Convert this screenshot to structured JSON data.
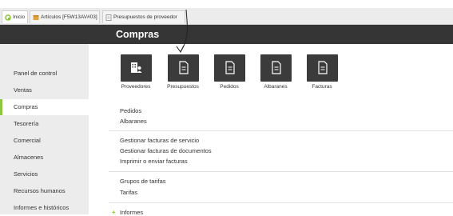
{
  "tabs": [
    {
      "label": "Inicio",
      "icon": "home-icon"
    },
    {
      "label": "Artículos [F5W13AV#03]",
      "icon": "box-icon"
    },
    {
      "label": "Presupuestos de proveedor",
      "icon": "document-icon"
    }
  ],
  "header": {
    "title": "Compras"
  },
  "sidebar": {
    "items": [
      {
        "label": "Panel de control"
      },
      {
        "label": "Ventas"
      },
      {
        "label": "Compras"
      },
      {
        "label": "Tesorería"
      },
      {
        "label": "Comercial"
      },
      {
        "label": "Almacenes"
      },
      {
        "label": "Servicios"
      },
      {
        "label": "Recursos humanos"
      },
      {
        "label": "Informes e históricos"
      }
    ],
    "active_index": 2
  },
  "tiles": [
    {
      "label": "Proveedores",
      "icon": "suppliers-icon"
    },
    {
      "label": "Presupuestos",
      "icon": "document-icon"
    },
    {
      "label": "Pedidos",
      "icon": "document-icon"
    },
    {
      "label": "Albaranes",
      "icon": "document-icon"
    },
    {
      "label": "Facturas",
      "icon": "document-icon"
    }
  ],
  "links": {
    "group1": [
      "Pedidos",
      "Albaranes"
    ],
    "group2": [
      "Gestionar facturas de servicio",
      "Gestionar facturas de documentos",
      "Imprimir o enviar facturas"
    ],
    "group3": [
      "Grupos de tarifas",
      "Tarifas"
    ],
    "informes": "Informes"
  },
  "colors": {
    "accent": "#8dc63f",
    "header_bg": "#353535",
    "tile_bg": "#3b3b3b",
    "sidebar_bg": "#ececec"
  }
}
